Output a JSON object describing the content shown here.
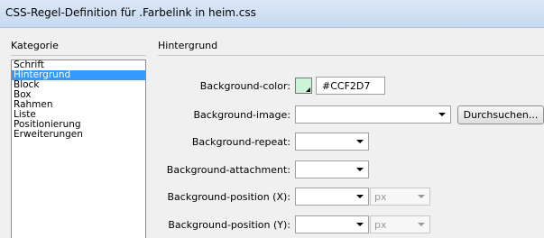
{
  "window": {
    "title": "CSS-Regel-Definition für .Farbelink in heim.css"
  },
  "headers": {
    "category": "Kategorie",
    "section": "Hintergrund"
  },
  "categories": [
    {
      "label": "Schrift"
    },
    {
      "label": "Hintergrund",
      "selected": true
    },
    {
      "label": "Block"
    },
    {
      "label": "Box"
    },
    {
      "label": "Rahmen"
    },
    {
      "label": "Liste"
    },
    {
      "label": "Positionierung"
    },
    {
      "label": "Erweiterungen"
    }
  ],
  "form": {
    "bg_color_label": "Background-color:",
    "bg_color_value": "#CCF2D7",
    "bg_image_label": "Background-image:",
    "browse_button": "Durchsuchen...",
    "bg_repeat_label": "Background-repeat:",
    "bg_attachment_label": "Background-attachment:",
    "bg_pos_x_label": "Background-position (X):",
    "bg_pos_x_unit": "px",
    "bg_pos_y_label": "Background-position (Y):",
    "bg_pos_y_unit": "px"
  },
  "colors": {
    "swatch": "#ccf2d7",
    "selection": "#3399ff"
  }
}
